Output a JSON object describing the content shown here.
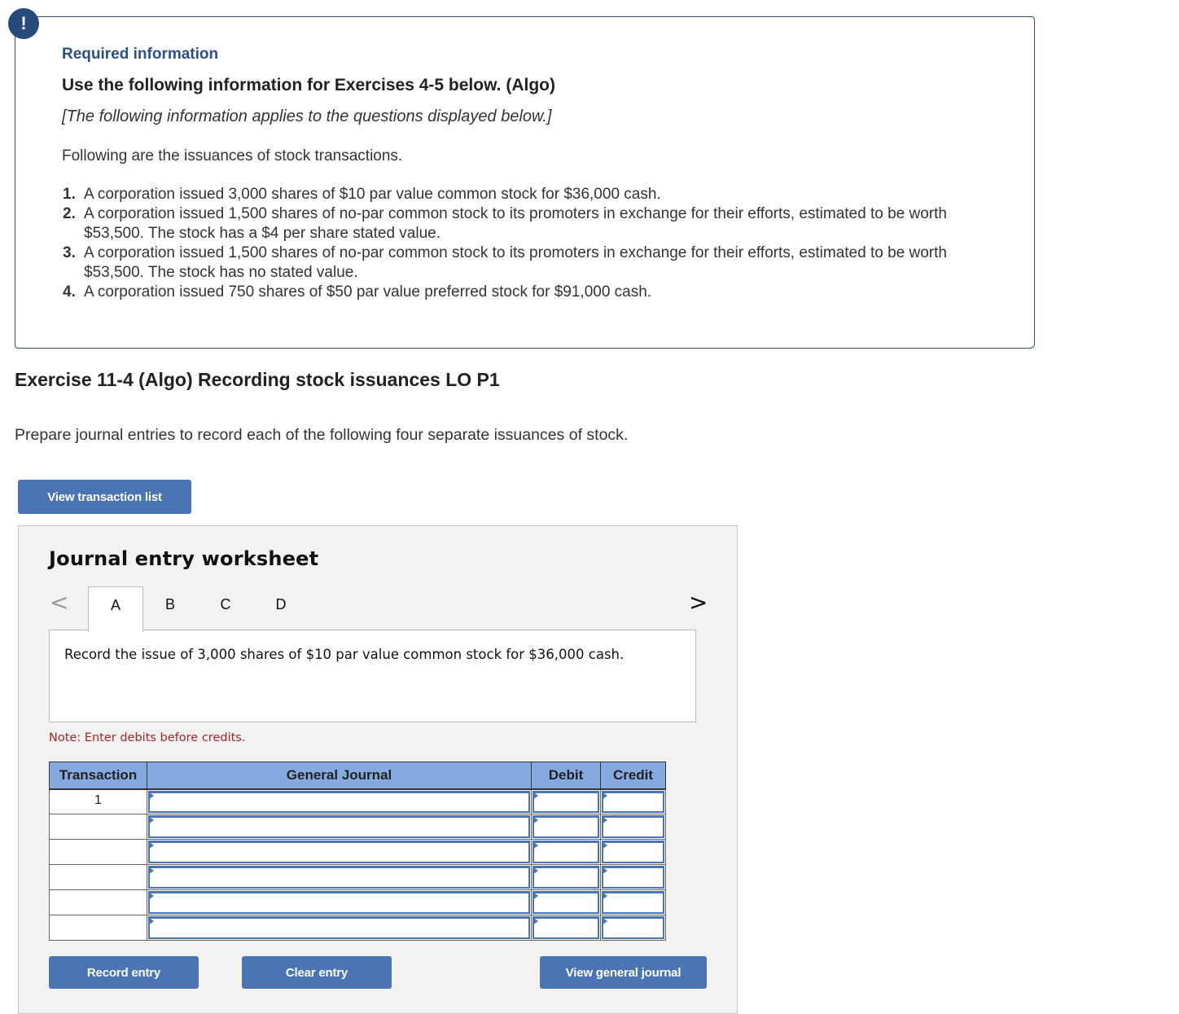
{
  "alert": {
    "icon": "exclamation-icon",
    "symbol": "!"
  },
  "info": {
    "required_label": "Required information",
    "use_title": "Use the following information for Exercises 4-5 below. (Algo)",
    "applies_note": "[The following information applies to the questions displayed below.]",
    "intro": "Following are the issuances of stock transactions.",
    "transactions": [
      {
        "num": "1.",
        "text": "A corporation issued 3,000 shares of $10 par value common stock for $36,000 cash."
      },
      {
        "num": "2.",
        "text": "A corporation issued 1,500 shares of no-par common stock to its promoters in exchange for their efforts, estimated to be worth $53,500. The stock has a $4 per share stated value."
      },
      {
        "num": "3.",
        "text": "A corporation issued 1,500 shares of no-par common stock to its promoters in exchange for their efforts, estimated to be worth $53,500. The stock has no stated value."
      },
      {
        "num": "4.",
        "text": "A corporation issued 750 shares of $50 par value preferred stock for $91,000 cash."
      }
    ]
  },
  "exercise": {
    "title": "Exercise 11-4 (Algo) Recording stock issuances LO P1",
    "instruction": "Prepare journal entries to record each of the following four separate issuances of stock.",
    "view_transaction_list_label": "View transaction list"
  },
  "worksheet": {
    "title": "Journal entry worksheet",
    "prev_icon": "chevron-left-icon",
    "prev_symbol": "<",
    "next_icon": "chevron-right-icon",
    "next_symbol": ">",
    "tabs": [
      {
        "label": "A",
        "active": true
      },
      {
        "label": "B",
        "active": false
      },
      {
        "label": "C",
        "active": false
      },
      {
        "label": "D",
        "active": false
      }
    ],
    "prompt": "Record the issue of 3,000 shares of $10 par value common stock for $36,000 cash.",
    "note": "Note: Enter debits before credits.",
    "table": {
      "headers": [
        "Transaction",
        "General Journal",
        "Debit",
        "Credit"
      ],
      "rows": [
        {
          "transaction": "1",
          "general_journal": "",
          "debit": "",
          "credit": ""
        },
        {
          "transaction": "",
          "general_journal": "",
          "debit": "",
          "credit": ""
        },
        {
          "transaction": "",
          "general_journal": "",
          "debit": "",
          "credit": ""
        },
        {
          "transaction": "",
          "general_journal": "",
          "debit": "",
          "credit": ""
        },
        {
          "transaction": "",
          "general_journal": "",
          "debit": "",
          "credit": ""
        },
        {
          "transaction": "",
          "general_journal": "",
          "debit": "",
          "credit": ""
        }
      ]
    },
    "buttons": {
      "record_entry": "Record entry",
      "clear_entry": "Clear entry",
      "view_general_journal": "View general journal"
    }
  },
  "colors": {
    "brand_blue": "#274a7d",
    "button_blue": "#4a74b4",
    "table_header": "#84aae0",
    "note_red": "#b22222"
  }
}
